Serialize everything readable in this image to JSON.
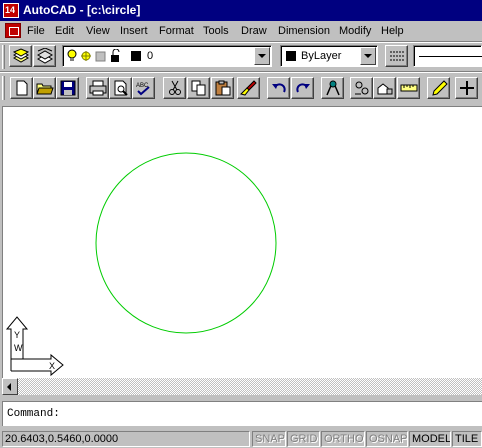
{
  "window": {
    "title": "AutoCAD - [c:\\circle]",
    "app_icon_text": "14"
  },
  "menu": [
    "File",
    "Edit",
    "View",
    "Insert",
    "Format",
    "Tools",
    "Draw",
    "Dimension",
    "Modify",
    "Help"
  ],
  "layer_combo": {
    "value": "0"
  },
  "color_combo": {
    "value": "ByLayer"
  },
  "drawing": {
    "circle_color": "#00cc00",
    "ucs_y": "Y",
    "ucs_w": "W",
    "ucs_x": "X"
  },
  "command_line": {
    "text": "Command:"
  },
  "status": {
    "coords": "20.6403,0.5460,0.0000",
    "snap": "SNAP",
    "grid": "GRID",
    "ortho": "ORTHO",
    "osnap": "OSNAP",
    "model": "MODEL",
    "tile": "TILE"
  },
  "colors": {
    "title_bg": "#000080",
    "chrome": "#c0c0c0",
    "canvas": "#ffffff"
  }
}
